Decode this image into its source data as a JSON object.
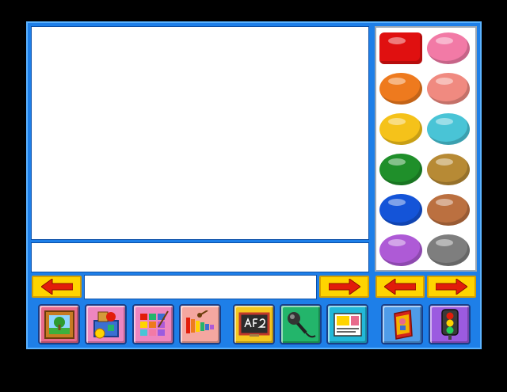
{
  "palette": {
    "colors": [
      {
        "name": "red",
        "hex": "#e01010",
        "selected": true
      },
      {
        "name": "pink",
        "hex": "#f27aa6"
      },
      {
        "name": "orange",
        "hex": "#ee7a1e"
      },
      {
        "name": "salmon",
        "hex": "#f08a80"
      },
      {
        "name": "yellow",
        "hex": "#f5c21a"
      },
      {
        "name": "teal",
        "hex": "#49c4d6"
      },
      {
        "name": "green",
        "hex": "#1f8f2a"
      },
      {
        "name": "tan",
        "hex": "#b78a35"
      },
      {
        "name": "blue",
        "hex": "#1454d8"
      },
      {
        "name": "brown",
        "hex": "#bb7040"
      },
      {
        "name": "purple",
        "hex": "#ae5ad6"
      },
      {
        "name": "gray",
        "hex": "#7e7e7e"
      }
    ]
  },
  "toolbar": {
    "tools": [
      {
        "name": "picture-frame-icon",
        "bg": "#e86a8c"
      },
      {
        "name": "toybox-icon",
        "bg": "#ee86c0"
      },
      {
        "name": "paint-palette-icon",
        "bg": "#ee86c0"
      },
      {
        "name": "xylophone-icon",
        "bg": "#f4a7a0"
      },
      {
        "name": "chalkboard-icon",
        "bg": "#f5c81f"
      },
      {
        "name": "microphone-icon",
        "bg": "#23b56b"
      },
      {
        "name": "photo-card-icon",
        "bg": "#22b8d8"
      },
      {
        "name": "book-icon",
        "bg": "#4f9ce8"
      },
      {
        "name": "traffic-light-icon",
        "bg": "#9b5be0"
      }
    ]
  },
  "colors": {
    "frame": "#1e7fe8",
    "button_yellow": "#ffd400",
    "arrow_red": "#e21c0a"
  }
}
